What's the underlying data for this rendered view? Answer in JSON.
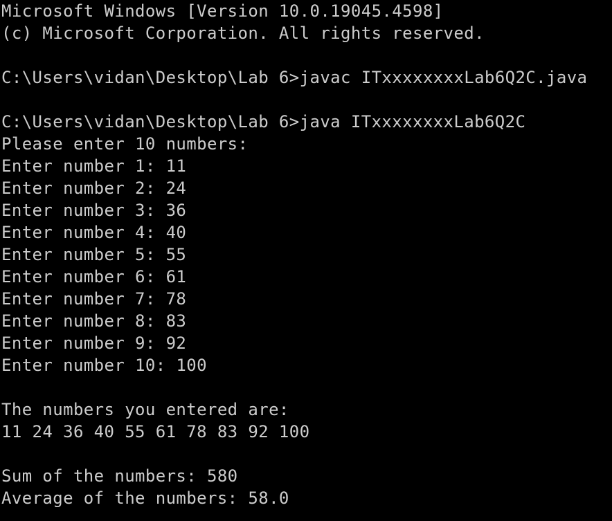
{
  "terminal": {
    "colors": {
      "background": "#000000",
      "text": "#cccccc"
    },
    "lines": [
      "Microsoft Windows [Version 10.0.19045.4598]",
      "(c) Microsoft Corporation. All rights reserved.",
      "",
      "C:\\Users\\vidan\\Desktop\\Lab 6>javac ITxxxxxxxxLab6Q2C.java",
      "",
      "C:\\Users\\vidan\\Desktop\\Lab 6>java ITxxxxxxxxLab6Q2C",
      "Please enter 10 numbers:",
      "Enter number 1: 11",
      "Enter number 2: 24",
      "Enter number 3: 36",
      "Enter number 4: 40",
      "Enter number 5: 55",
      "Enter number 6: 61",
      "Enter number 7: 78",
      "Enter number 8: 83",
      "Enter number 9: 92",
      "Enter number 10: 100",
      "",
      "The numbers you entered are:",
      "11 24 36 40 55 61 78 83 92 100",
      "",
      "Sum of the numbers: 580",
      "Average of the numbers: 58.0"
    ]
  }
}
